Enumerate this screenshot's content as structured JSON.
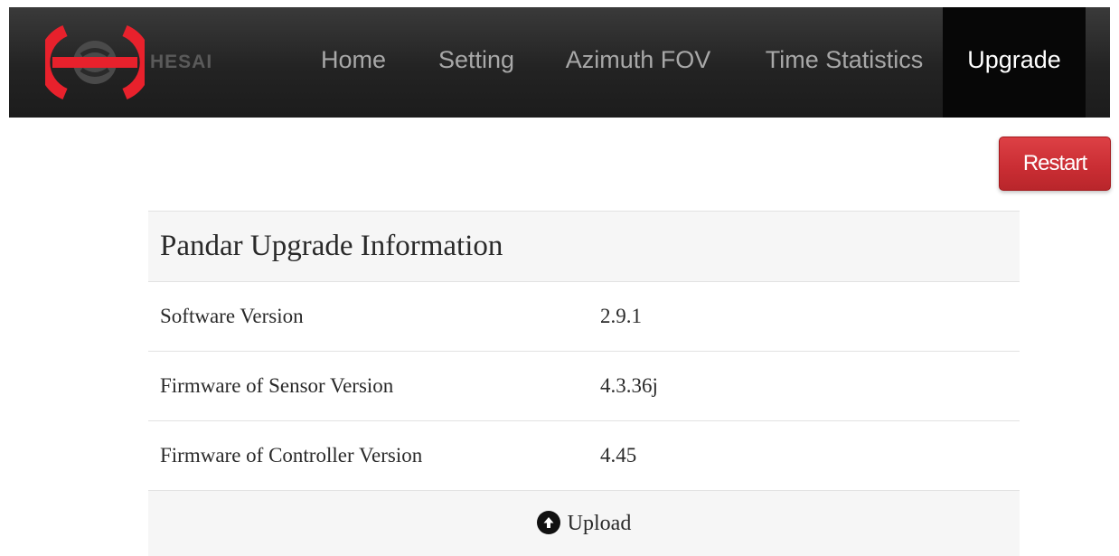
{
  "nav": {
    "brand": "HESAI",
    "items": [
      {
        "label": "Home",
        "active": false
      },
      {
        "label": "Setting",
        "active": false
      },
      {
        "label": "Azimuth FOV",
        "active": false
      },
      {
        "label": "Time Statistics",
        "active": false
      },
      {
        "label": "Upgrade",
        "active": true
      }
    ]
  },
  "restart_label": "Restart",
  "panel": {
    "title": "Pandar Upgrade Information",
    "rows": [
      {
        "label": "Software Version",
        "value": "2.9.1"
      },
      {
        "label": "Firmware of Sensor Version",
        "value": "4.3.36j"
      },
      {
        "label": "Firmware of Controller Version",
        "value": "4.45"
      }
    ],
    "upload_label": "Upload",
    "upload_icon": "circle-arrow-up-icon"
  },
  "colors": {
    "navbar": "#2b2b2b",
    "nav_active_bg": "#070707",
    "brand_red": "#e8212c",
    "restart": "#d0343a"
  }
}
